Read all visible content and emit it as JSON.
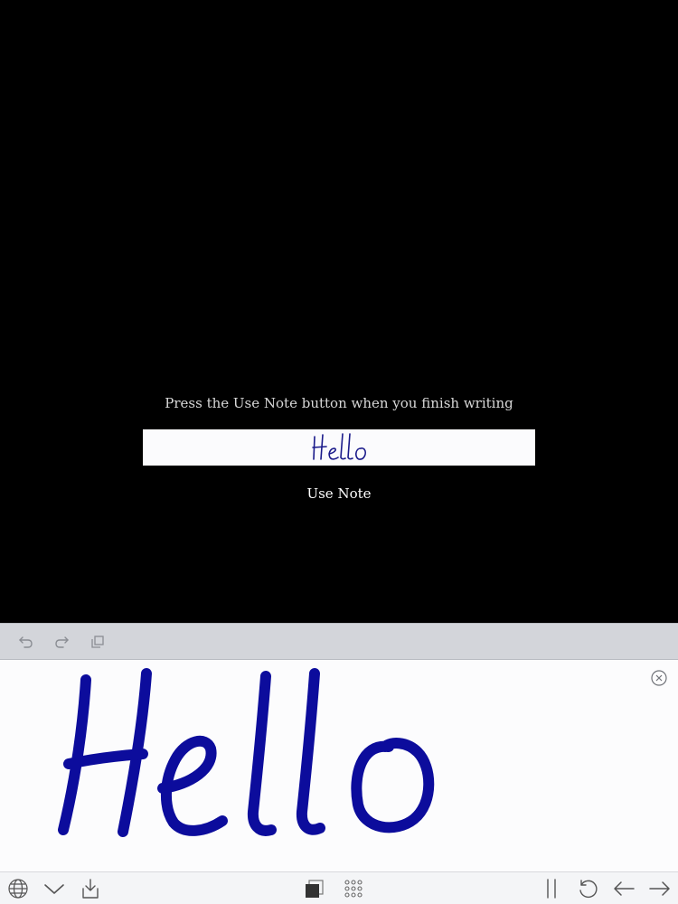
{
  "prompt": {
    "instruction": "Press the Use Note button when you finish writing"
  },
  "note": {
    "text": "Hello",
    "use_label": "Use Note"
  },
  "ink": {
    "color": "#0a0a9a",
    "text": "Hello"
  },
  "icons": {
    "undo": "undo-icon",
    "redo": "redo-icon",
    "duplicate": "copy-icon",
    "clear": "clear-circle-x-icon",
    "globe": "globe-icon",
    "dismiss": "chevron-down-icon",
    "insert": "download-tray-icon",
    "color": "color-square-icon",
    "grid": "grid-icon",
    "space": "space-icon",
    "rotate": "rotate-icon",
    "back": "arrow-left-icon",
    "forward": "arrow-right-icon"
  }
}
